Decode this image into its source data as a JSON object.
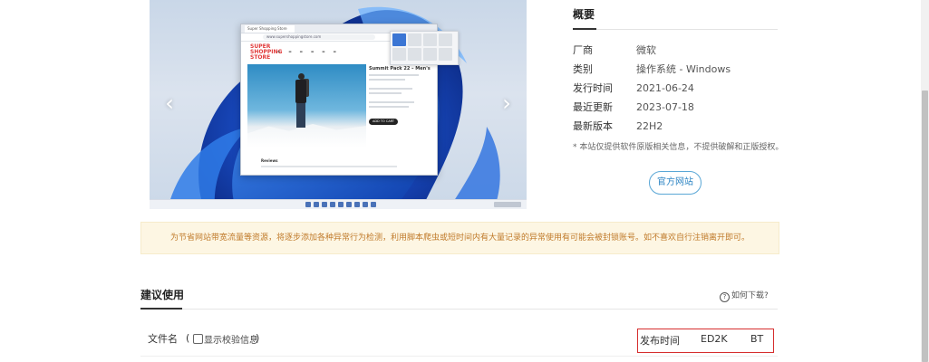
{
  "carousel": {
    "prev_icon": "chevron-left-icon",
    "next_icon": "chevron-right-icon",
    "prev_glyph": "‹",
    "next_glyph": "›",
    "mockup": {
      "tab_title": "Super Shopping Store",
      "url": "www.supershoppingstore.com",
      "logo": "SUPER SHOPPING STORE",
      "product_title": "Summit Pack 22 – Men's",
      "button_label": "ADD TO CART",
      "reviews_label": "Reviews"
    }
  },
  "overview": {
    "title": "概要",
    "rows": [
      {
        "key": "厂商",
        "value": "微软"
      },
      {
        "key": "类别",
        "value": "操作系统 - Windows"
      },
      {
        "key": "发行时间",
        "value": "2021-06-24"
      },
      {
        "key": "最近更新",
        "value": "2023-07-18"
      },
      {
        "key": "最新版本",
        "value": "22H2"
      }
    ],
    "note": "* 本站仅提供软件原版相关信息，不提供破解和正版授权。",
    "official_button": "官方网站"
  },
  "notice": {
    "text": "为节省网站带宽流量等资源，将逐步添加各种异常行为检测，利用脚本爬虫或短时间内有大量记录的异常使用有可能会被封锁账号。如不喜欢自行注销离开即可。"
  },
  "recommend": {
    "title": "建议使用",
    "howto_label": "如何下载?",
    "howto_icon": "question-circle-icon",
    "filename_label": "文件名",
    "paren_open": "(",
    "paren_close": ")",
    "checksum_label": "显示校验信息",
    "columns": [
      "发布时间",
      "ED2K",
      "BT"
    ],
    "highlight_color": "#d62e2e"
  }
}
